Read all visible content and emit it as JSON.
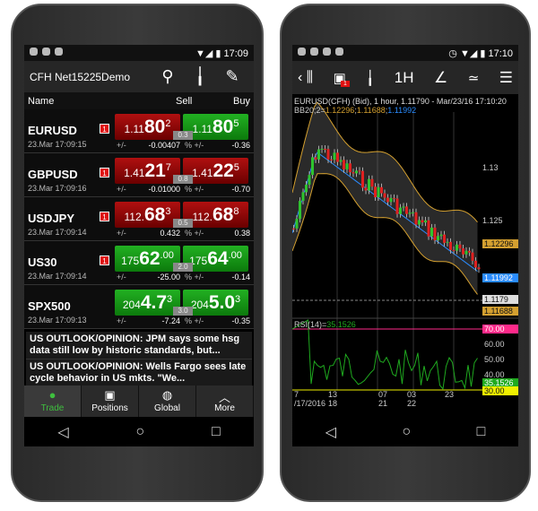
{
  "left": {
    "status": {
      "time": "17:09"
    },
    "toolbar": {
      "account": "CFH Net15225Demo",
      "icons": [
        "search-icon",
        "chart-icon",
        "edit-icon"
      ]
    },
    "header": {
      "name": "Name",
      "sell": "Sell",
      "buy": "Buy"
    },
    "rows": [
      {
        "symbol": "EURUSD",
        "time": "23.Mar 17:09:15",
        "badge": "1",
        "color": "red",
        "buy_color": "green",
        "sell": {
          "a": "1.11",
          "b": "80",
          "c": "2"
        },
        "buy": {
          "a": "1.11",
          "b": "80",
          "c": "5"
        },
        "spread": "0.3",
        "chg_label": "+/-",
        "chg": "-0.00407",
        "pct_label": "% +/-",
        "pct": "-0.36"
      },
      {
        "symbol": "GBPUSD",
        "time": "23.Mar 17:09:16",
        "badge": "1",
        "color": "red",
        "buy_color": "red",
        "sell": {
          "a": "1.41",
          "b": "21",
          "c": "7"
        },
        "buy": {
          "a": "1.41",
          "b": "22",
          "c": "5"
        },
        "spread": "0.8",
        "chg_label": "+/-",
        "chg": "-0.01000",
        "pct_label": "% +/-",
        "pct": "-0.70"
      },
      {
        "symbol": "USDJPY",
        "time": "23.Mar 17:09:14",
        "badge": "1",
        "color": "red",
        "buy_color": "red",
        "sell": {
          "a": "112.",
          "b": "68",
          "c": "3"
        },
        "buy": {
          "a": "112.",
          "b": "68",
          "c": "8"
        },
        "spread": "0.5",
        "chg_label": "+/-",
        "chg": "0.432",
        "pct_label": "% +/-",
        "pct": "0.38"
      },
      {
        "symbol": "US30",
        "time": "23.Mar 17:09:14",
        "badge": "1",
        "color": "green",
        "buy_color": "green",
        "sell": {
          "a": "175",
          "b": "62",
          "c": ".00"
        },
        "buy": {
          "a": "175",
          "b": "64",
          "c": ".00"
        },
        "spread": "2.0",
        "chg_label": "+/-",
        "chg": "-25.00",
        "pct_label": "% +/-",
        "pct": "-0.14"
      },
      {
        "symbol": "SPX500",
        "time": "23.Mar 17:09:13",
        "badge": "",
        "color": "green",
        "buy_color": "green",
        "sell": {
          "a": "204",
          "b": "4.7",
          "c": "3"
        },
        "buy": {
          "a": "204",
          "b": "5.0",
          "c": "3"
        },
        "spread": "3.0",
        "chg_label": "+/-",
        "chg": "-7.24",
        "pct_label": "% +/-",
        "pct": "-0.35"
      }
    ],
    "news": [
      "US OUTLOOK/OPINION: JPM says some hsg data still low by historic standards, but...",
      "US OUTLOOK/OPINION: Wells Fargo sees late cycle behavior in US mkts. \"We..."
    ],
    "tabs": [
      {
        "label": "Trade",
        "icon": "trade-icon",
        "active": true
      },
      {
        "label": "Positions",
        "icon": "briefcase-icon"
      },
      {
        "label": "Global",
        "icon": "globe-icon"
      },
      {
        "label": "More",
        "icon": "chevron-up-icon"
      }
    ]
  },
  "right": {
    "status": {
      "time": "17:10"
    },
    "toolbar": {
      "badge": "1",
      "timeframe": "1H"
    },
    "chart": {
      "title": "EURUSD(CFH) (Bid), 1 hour, 1.11790 - Mar/23/16 17:10:20",
      "bb_label": "BB20;2=",
      "bb_upper": "1.12296",
      "bb_lower": "1.11688",
      "bb_mid": "1.11992",
      "price_ticks": [
        "1.13",
        "1.125"
      ],
      "last": "1.1179",
      "rsi_label": "RSI(14)=",
      "rsi_value": "35.1526",
      "rsi_ticks": [
        "70.00",
        "60.00",
        "50.00",
        "40.00",
        "30.00"
      ],
      "x_ticks": [
        {
          "d": "7",
          "s": "/17/2016"
        },
        {
          "d": "13",
          "s": "18"
        },
        {
          "d": "07",
          "s": "21"
        },
        {
          "d": "03",
          "s": "22"
        },
        {
          "d": "23",
          "s": ""
        }
      ],
      "colors": {
        "upper": "#d4a030",
        "mid": "#2a8cff",
        "rsi": "#1faa1f",
        "hi": "#ff2a8a",
        "lo": "#f0f000"
      }
    }
  }
}
